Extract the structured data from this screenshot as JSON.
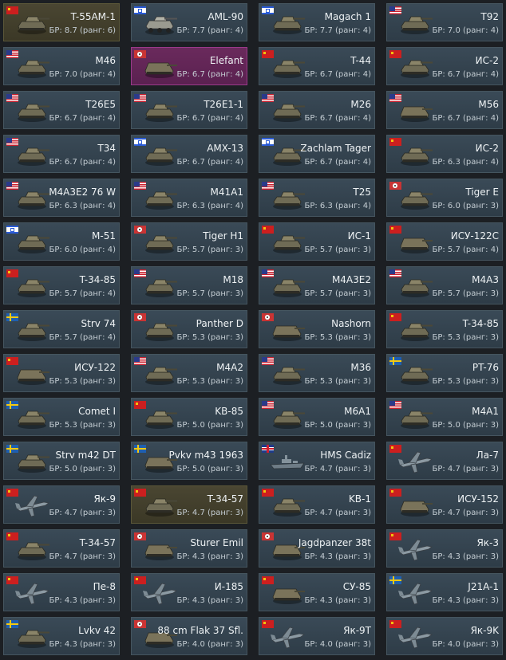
{
  "cards": [
    {
      "name": "T-55AM-1",
      "stats": "БР: 8.7 (ранг: 6)",
      "flag": "ussr",
      "icon": "tank-icon",
      "state": "premium"
    },
    {
      "name": "AML-90",
      "stats": "БР: 7.7 (ранг: 4)",
      "flag": "israel",
      "icon": "armored-car-icon",
      "state": "normal"
    },
    {
      "name": "Magach 1",
      "stats": "БР: 7.7 (ранг: 4)",
      "flag": "israel",
      "icon": "tank-icon",
      "state": "normal"
    },
    {
      "name": "T92",
      "stats": "БР: 7.0 (ранг: 4)",
      "flag": "usa",
      "icon": "tank-icon",
      "state": "normal"
    },
    {
      "name": "M46",
      "stats": "БР: 7.0 (ранг: 4)",
      "flag": "usa",
      "icon": "tank-icon",
      "state": "normal"
    },
    {
      "name": "Elefant",
      "stats": "БР: 6.7 (ранг: 4)",
      "flag": "germany",
      "icon": "tank-destroyer-icon",
      "state": "selected"
    },
    {
      "name": "T-44",
      "stats": "БР: 6.7 (ранг: 4)",
      "flag": "ussr",
      "icon": "tank-icon",
      "state": "normal"
    },
    {
      "name": "ИС-2",
      "stats": "БР: 6.7 (ранг: 4)",
      "flag": "ussr",
      "icon": "tank-icon",
      "state": "normal"
    },
    {
      "name": "T26E5",
      "stats": "БР: 6.7 (ранг: 4)",
      "flag": "usa",
      "icon": "tank-icon",
      "state": "normal"
    },
    {
      "name": "T26E1-1",
      "stats": "БР: 6.7 (ранг: 4)",
      "flag": "usa",
      "icon": "tank-icon",
      "state": "normal"
    },
    {
      "name": "M26",
      "stats": "БР: 6.7 (ранг: 4)",
      "flag": "usa",
      "icon": "tank-icon",
      "state": "normal"
    },
    {
      "name": "M56",
      "stats": "БР: 6.7 (ранг: 4)",
      "flag": "usa",
      "icon": "tank-destroyer-icon",
      "state": "normal"
    },
    {
      "name": "T34",
      "stats": "БР: 6.7 (ранг: 4)",
      "flag": "usa",
      "icon": "tank-icon",
      "state": "normal"
    },
    {
      "name": "AMX-13",
      "stats": "БР: 6.7 (ранг: 4)",
      "flag": "israel",
      "icon": "tank-icon",
      "state": "normal"
    },
    {
      "name": "Zachlam Tager",
      "stats": "БР: 6.7 (ранг: 4)",
      "flag": "israel",
      "icon": "tank-icon",
      "state": "normal"
    },
    {
      "name": "ИС-2",
      "stats": "БР: 6.3 (ранг: 4)",
      "flag": "ussr",
      "icon": "tank-icon",
      "state": "normal"
    },
    {
      "name": "M4A3E2 76 W",
      "stats": "БР: 6.3 (ранг: 4)",
      "flag": "usa",
      "icon": "tank-icon",
      "state": "normal"
    },
    {
      "name": "M41A1",
      "stats": "БР: 6.3 (ранг: 4)",
      "flag": "usa",
      "icon": "tank-icon",
      "state": "normal"
    },
    {
      "name": "T25",
      "stats": "БР: 6.3 (ранг: 4)",
      "flag": "usa",
      "icon": "tank-icon",
      "state": "normal"
    },
    {
      "name": "Tiger E",
      "stats": "БР: 6.0 (ранг: 3)",
      "flag": "germany",
      "icon": "tank-icon",
      "state": "normal"
    },
    {
      "name": "M-51",
      "stats": "БР: 6.0 (ранг: 4)",
      "flag": "israel",
      "icon": "tank-icon",
      "state": "normal"
    },
    {
      "name": "Tiger H1",
      "stats": "БР: 5.7 (ранг: 3)",
      "flag": "germany",
      "icon": "tank-icon",
      "state": "normal"
    },
    {
      "name": "ИС-1",
      "stats": "БР: 5.7 (ранг: 3)",
      "flag": "ussr",
      "icon": "tank-icon",
      "state": "normal"
    },
    {
      "name": "ИСУ-122С",
      "stats": "БР: 5.7 (ранг: 4)",
      "flag": "ussr",
      "icon": "tank-destroyer-icon",
      "state": "normal"
    },
    {
      "name": "T-34-85",
      "stats": "БР: 5.7 (ранг: 4)",
      "flag": "ussr",
      "icon": "tank-icon",
      "state": "normal"
    },
    {
      "name": "M18",
      "stats": "БР: 5.7 (ранг: 3)",
      "flag": "usa",
      "icon": "tank-icon",
      "state": "normal"
    },
    {
      "name": "M4A3E2",
      "stats": "БР: 5.7 (ранг: 3)",
      "flag": "usa",
      "icon": "tank-icon",
      "state": "normal"
    },
    {
      "name": "M4A3",
      "stats": "БР: 5.7 (ранг: 3)",
      "flag": "usa",
      "icon": "tank-icon",
      "state": "normal"
    },
    {
      "name": "Strv 74",
      "stats": "БР: 5.7 (ранг: 4)",
      "flag": "sweden",
      "icon": "tank-icon",
      "state": "normal"
    },
    {
      "name": "Panther D",
      "stats": "БР: 5.3 (ранг: 3)",
      "flag": "germany",
      "icon": "tank-icon",
      "state": "normal"
    },
    {
      "name": "Nashorn",
      "stats": "БР: 5.3 (ранг: 3)",
      "flag": "germany",
      "icon": "tank-destroyer-icon",
      "state": "normal"
    },
    {
      "name": "T-34-85",
      "stats": "БР: 5.3 (ранг: 3)",
      "flag": "ussr",
      "icon": "tank-icon",
      "state": "normal"
    },
    {
      "name": "ИСУ-122",
      "stats": "БР: 5.3 (ранг: 3)",
      "flag": "ussr",
      "icon": "tank-destroyer-icon",
      "state": "normal"
    },
    {
      "name": "M4A2",
      "stats": "БР: 5.3 (ранг: 3)",
      "flag": "usa",
      "icon": "tank-icon",
      "state": "normal"
    },
    {
      "name": "M36",
      "stats": "БР: 5.3 (ранг: 3)",
      "flag": "usa",
      "icon": "tank-icon",
      "state": "normal"
    },
    {
      "name": "PT-76",
      "stats": "БР: 5.3 (ранг: 3)",
      "flag": "sweden",
      "icon": "tank-icon",
      "state": "normal"
    },
    {
      "name": "Comet I",
      "stats": "БР: 5.3 (ранг: 3)",
      "flag": "sweden",
      "icon": "tank-icon",
      "state": "normal"
    },
    {
      "name": "KB-85",
      "stats": "БР: 5.0 (ранг: 3)",
      "flag": "ussr",
      "icon": "tank-icon",
      "state": "normal"
    },
    {
      "name": "M6A1",
      "stats": "БР: 5.0 (ранг: 3)",
      "flag": "usa",
      "icon": "tank-icon",
      "state": "normal"
    },
    {
      "name": "M4A1",
      "stats": "БР: 5.0 (ранг: 3)",
      "flag": "usa",
      "icon": "tank-icon",
      "state": "normal"
    },
    {
      "name": "Strv m42 DT",
      "stats": "БР: 5.0 (ранг: 3)",
      "flag": "sweden",
      "icon": "tank-icon",
      "state": "normal"
    },
    {
      "name": "Pvkv m43 1963",
      "stats": "БР: 5.0 (ранг: 3)",
      "flag": "sweden",
      "icon": "tank-destroyer-icon",
      "state": "normal"
    },
    {
      "name": "HMS Cadiz",
      "stats": "БР: 4.7 (ранг: 3)",
      "flag": "uk",
      "icon": "ship-icon",
      "state": "normal"
    },
    {
      "name": "Ла-7",
      "stats": "БР: 4.7 (ранг: 3)",
      "flag": "ussr",
      "icon": "plane-icon",
      "state": "normal"
    },
    {
      "name": "Як-9",
      "stats": "БР: 4.7 (ранг: 3)",
      "flag": "ussr",
      "icon": "plane-icon",
      "state": "normal"
    },
    {
      "name": "T-34-57",
      "stats": "БР: 4.7 (ранг: 3)",
      "flag": "ussr",
      "icon": "tank-icon",
      "state": "premium"
    },
    {
      "name": "KB-1",
      "stats": "БР: 4.7 (ранг: 3)",
      "flag": "ussr",
      "icon": "tank-icon",
      "state": "normal"
    },
    {
      "name": "ИСУ-152",
      "stats": "БР: 4.7 (ранг: 3)",
      "flag": "ussr",
      "icon": "tank-destroyer-icon",
      "state": "normal"
    },
    {
      "name": "T-34-57",
      "stats": "БР: 4.7 (ранг: 3)",
      "flag": "ussr",
      "icon": "tank-icon",
      "state": "normal"
    },
    {
      "name": "Sturer Emil",
      "stats": "БР: 4.3 (ранг: 3)",
      "flag": "germany",
      "icon": "tank-destroyer-icon",
      "state": "normal"
    },
    {
      "name": "Jagdpanzer 38t",
      "stats": "БР: 4.3 (ранг: 3)",
      "flag": "germany",
      "icon": "tank-destroyer-icon",
      "state": "normal"
    },
    {
      "name": "Як-3",
      "stats": "БР: 4.3 (ранг: 3)",
      "flag": "ussr",
      "icon": "plane-icon",
      "state": "normal"
    },
    {
      "name": "Пе-8",
      "stats": "БР: 4.3 (ранг: 3)",
      "flag": "ussr",
      "icon": "plane-icon",
      "state": "normal"
    },
    {
      "name": "И-185",
      "stats": "БР: 4.3 (ранг: 3)",
      "flag": "ussr",
      "icon": "plane-icon",
      "state": "normal"
    },
    {
      "name": "СУ-85",
      "stats": "БР: 4.3 (ранг: 3)",
      "flag": "ussr",
      "icon": "tank-destroyer-icon",
      "state": "normal"
    },
    {
      "name": "J21A-1",
      "stats": "БР: 4.3 (ранг: 3)",
      "flag": "sweden",
      "icon": "plane-icon",
      "state": "normal"
    },
    {
      "name": "Lvkv 42",
      "stats": "БР: 4.3 (ранг: 3)",
      "flag": "sweden",
      "icon": "tank-icon",
      "state": "normal"
    },
    {
      "name": "88 cm Flak 37 Sfl.",
      "stats": "БР: 4.0 (ранг: 3)",
      "flag": "germany",
      "icon": "tank-destroyer-icon",
      "state": "normal"
    },
    {
      "name": "Як-9T",
      "stats": "БР: 4.0 (ранг: 3)",
      "flag": "ussr",
      "icon": "plane-icon",
      "state": "normal"
    },
    {
      "name": "Як-9K",
      "stats": "БР: 4.0 (ранг: 3)",
      "flag": "ussr",
      "icon": "plane-icon",
      "state": "normal"
    }
  ]
}
